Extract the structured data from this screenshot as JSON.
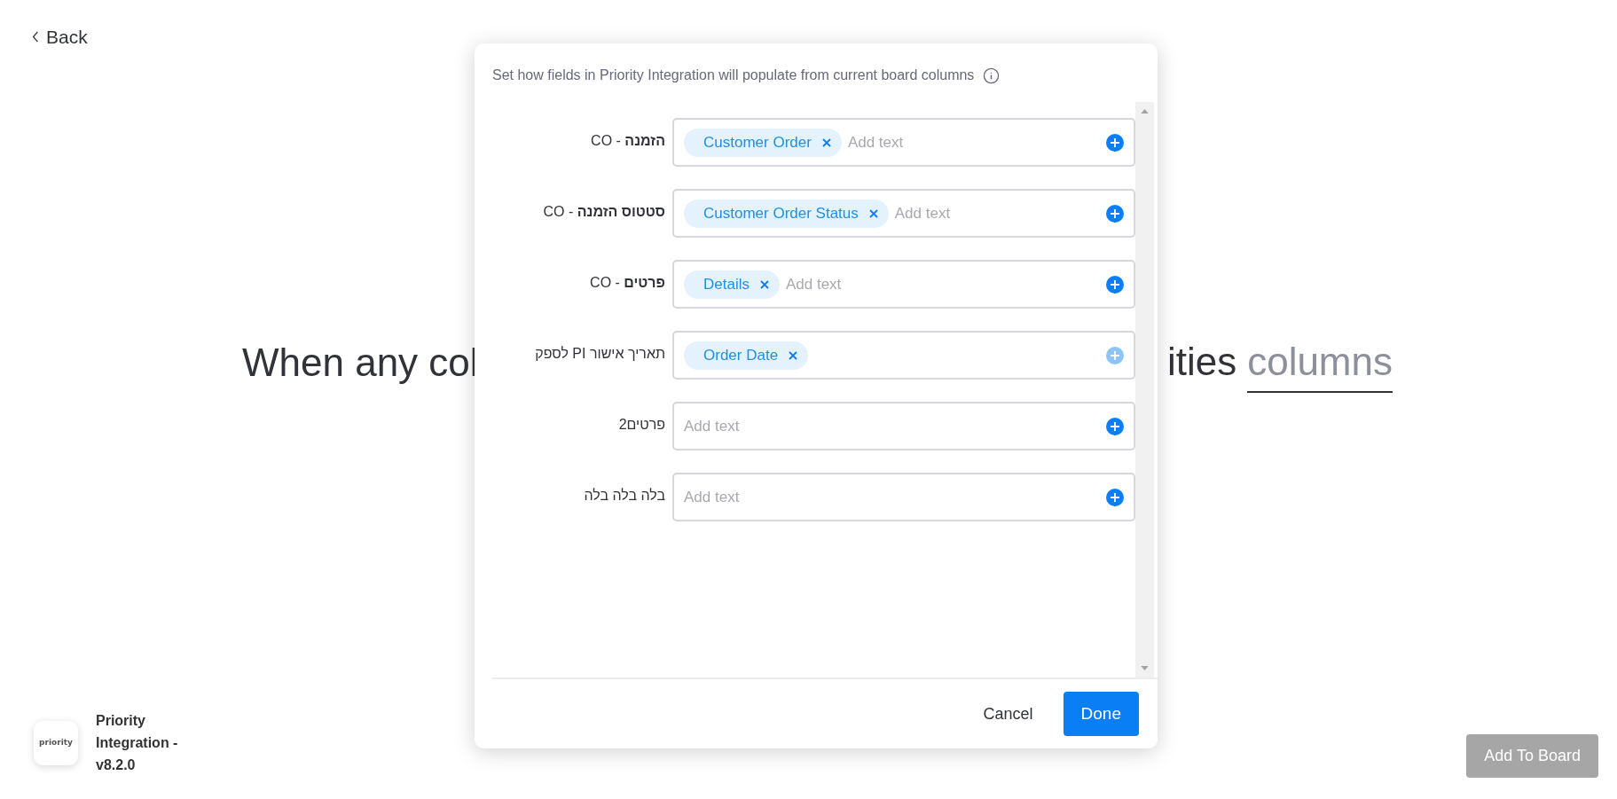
{
  "back_link": {
    "label": "Back"
  },
  "sentence": {
    "start": "When any col",
    "end": "ities",
    "link": "columns"
  },
  "app": {
    "name": "Priority Integration - v8.2.0",
    "logo_text": "priority"
  },
  "add_button": {
    "label": "Add To Board",
    "disabled": true
  },
  "dialog": {
    "description": "Set how fields in Priority Integration will populate from current board columns",
    "fields": [
      {
        "label": "**הזמנה** - CO",
        "tags": [
          "Customer Order"
        ],
        "placeholder": "Add text",
        "add_disabled": false
      },
      {
        "label": "**סטטוס הזמנה** - CO",
        "tags": [
          "Customer Order Status"
        ],
        "placeholder": "Add text",
        "add_disabled": false
      },
      {
        "label": "**פרטים** - CO",
        "tags": [
          "Details"
        ],
        "placeholder": "Add text",
        "add_disabled": false
      },
      {
        "label": "תאריך אישור PI לספק",
        "tags": [
          "Order Date"
        ],
        "add_disabled": true
      },
      {
        "label": "פרטים2",
        "placeholder": "Add text",
        "add_disabled": false
      },
      {
        "label": "בלה בלה בלה",
        "placeholder": "Add text",
        "add_disabled": false
      }
    ],
    "cancel": "Cancel",
    "done": "Done"
  }
}
